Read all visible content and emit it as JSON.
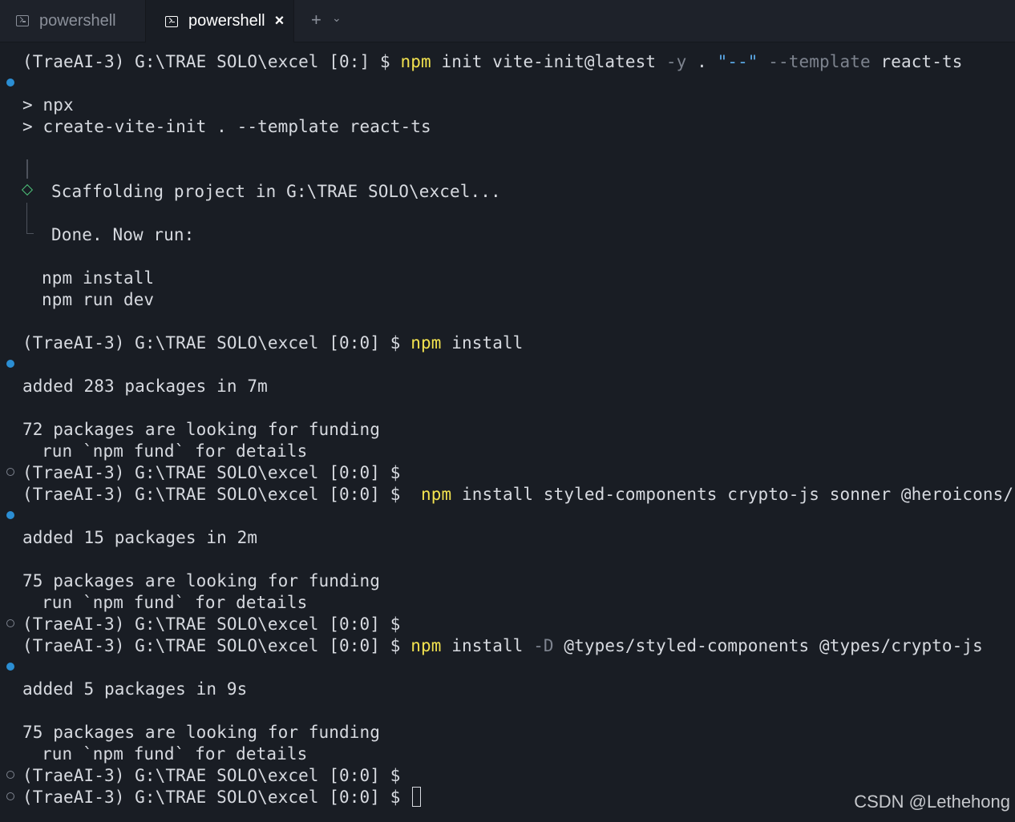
{
  "tabs": [
    {
      "label": "powershell",
      "icon": "terminal-icon",
      "active": false
    },
    {
      "label": "powershell",
      "icon": "terminal-icon",
      "active": true,
      "close": "×"
    }
  ],
  "tab_actions": {
    "new_tab": "+",
    "dropdown": "⌄"
  },
  "terminal": {
    "prompt": "(TraeAI-3) G:\\TRAE SOLO\\excel [0:0] $",
    "first_prompt": "(TraeAI-3) G:\\TRAE SOLO\\excel [0:] $",
    "cmd1": {
      "npm": "npm",
      "rest1": " init vite-init@latest ",
      "flag_y": "-y",
      "dot": " . ",
      "str": "\"--\"",
      "flag_template": " --template",
      "value": " react-ts"
    },
    "npx_line1": "> npx",
    "npx_line2": "> create-vite-init . --template react-ts",
    "scaffold": "Scaffolding project in G:\\TRAE SOLO\\excel...",
    "done": "Done. Now run:",
    "run1": "npm install",
    "run2": "npm run dev",
    "cmd2": {
      "npm": "npm",
      "rest": " install"
    },
    "added1": "added 283 packages in 7m",
    "fund1": "72 packages are looking for funding",
    "fund_details": "run `npm fund` for details",
    "cmd3": {
      "npm": "npm",
      "rest": " install styled-components crypto-js sonner @heroicons/react"
    },
    "added2": "added 15 packages in 2m",
    "fund2": "75 packages are looking for funding",
    "cmd4": {
      "npm": "npm",
      "rest1": " install ",
      "flag": "-D",
      "rest2": " @types/styled-components @types/crypto-js"
    },
    "added3": "added 5 packages in 9s",
    "fund3": "75 packages are looking for funding"
  },
  "watermark": "CSDN @Lethehong",
  "colors": {
    "background": "#191d24",
    "text": "#d7dae0",
    "command": "#f2e24f",
    "flag": "#7d838e",
    "string": "#5ba8e6",
    "success_dot": "#2b8ed3",
    "diamond": "#4ec27a"
  }
}
